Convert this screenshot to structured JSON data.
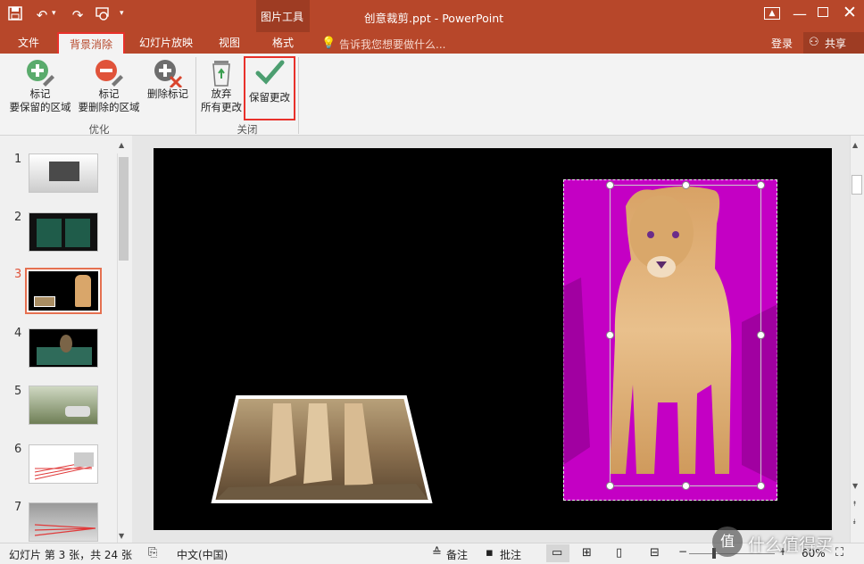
{
  "window": {
    "title": "创意裁剪.ppt - PowerPoint",
    "context_tab": "图片工具",
    "login": "登录",
    "share": "共享"
  },
  "tabs": [
    {
      "label": "文件"
    },
    {
      "label": "背景消除"
    },
    {
      "label": "幻灯片放映"
    },
    {
      "label": "视图"
    },
    {
      "label": "格式"
    }
  ],
  "tell_me": "告诉我您想要做什么...",
  "ribbon": {
    "mark_keep": {
      "line1": "标记",
      "line2": "要保留的区域"
    },
    "mark_remove": {
      "line1": "标记",
      "line2": "要删除的区域"
    },
    "delete_mark": {
      "label": "删除标记"
    },
    "discard": {
      "line1": "放弃",
      "line2": "所有更改"
    },
    "keep_changes": {
      "label": "保留更改"
    },
    "group_refine": "优化",
    "group_close": "关闭"
  },
  "slides": [
    {
      "num": "1"
    },
    {
      "num": "2"
    },
    {
      "num": "3"
    },
    {
      "num": "4"
    },
    {
      "num": "5"
    },
    {
      "num": "6"
    },
    {
      "num": "7"
    }
  ],
  "status": {
    "slide_info": "幻灯片 第 3 张，共 24 张",
    "language": "中文(中国)",
    "notes": "备注",
    "comments": "批注",
    "zoom": "60%",
    "watermark": "什么值得买"
  },
  "colors": {
    "accent": "#b7472a",
    "highlight_box": "#e8312b",
    "removal_overlay": "#c400c4"
  }
}
